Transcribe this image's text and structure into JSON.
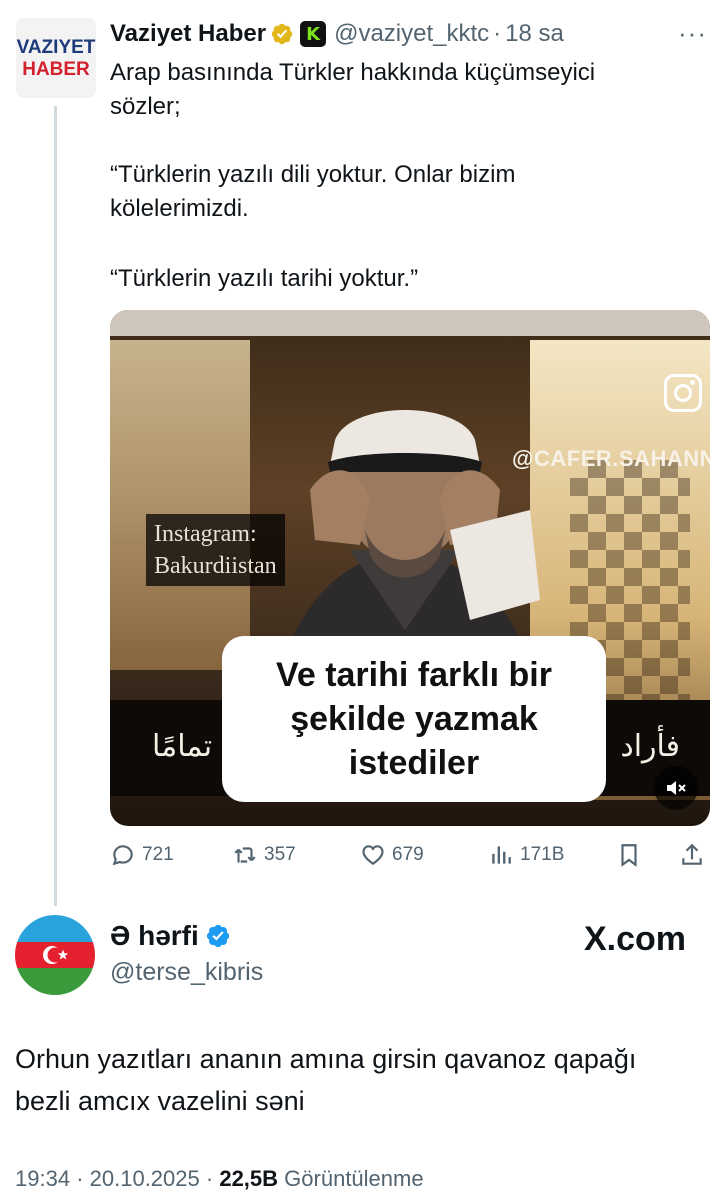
{
  "parent_tweet": {
    "avatar": {
      "line1": "VAZIYET",
      "line2": "HABER"
    },
    "display_name": "Vaziyet Haber",
    "badge_letter": "K",
    "handle": "@vaziyet_kktc",
    "separator": "·",
    "time": "18 sa",
    "more": "···",
    "text_lines": [
      "Arap basınında Türkler hakkında küçümseyici",
      "sözler;",
      "“Türklerin yazılı dili yoktur. Onlar bizim",
      "kölelerimizdi.",
      "“Türklerin yazılı tarihi yoktur.”"
    ],
    "video": {
      "watermark": "@CAFER.SAHANN",
      "instagram_overlay": [
        "Instagram:",
        "Bakurdiistan"
      ],
      "subtitle_lines": [
        "Ve tarihi farklı bir",
        "şekilde yazmak",
        "istediler"
      ],
      "arabic_left": "لله تمامًا",
      "arabic_right": "فأراد"
    },
    "actions": {
      "replies": "721",
      "retweets": "357",
      "likes": "679",
      "views": "171B"
    }
  },
  "main_tweet": {
    "display_name": "Ə hərfi",
    "handle": "@terse_kibris",
    "watermark": "X.com",
    "text_lines": [
      "Orhun yazıtları ananın amına girsin qavanoz qapağı",
      "bezli amcıx vazelini səni"
    ],
    "time": "19:34",
    "date": "20.10.2025",
    "separator": "·",
    "views_count": "22,5B",
    "views_label": "Görüntülenme"
  },
  "colors": {
    "text": "#0f1419",
    "secondary": "#536471",
    "verified_blue": "#1d9bf0",
    "verified_gold": "#e2b719",
    "haber_red": "#d3212d"
  }
}
